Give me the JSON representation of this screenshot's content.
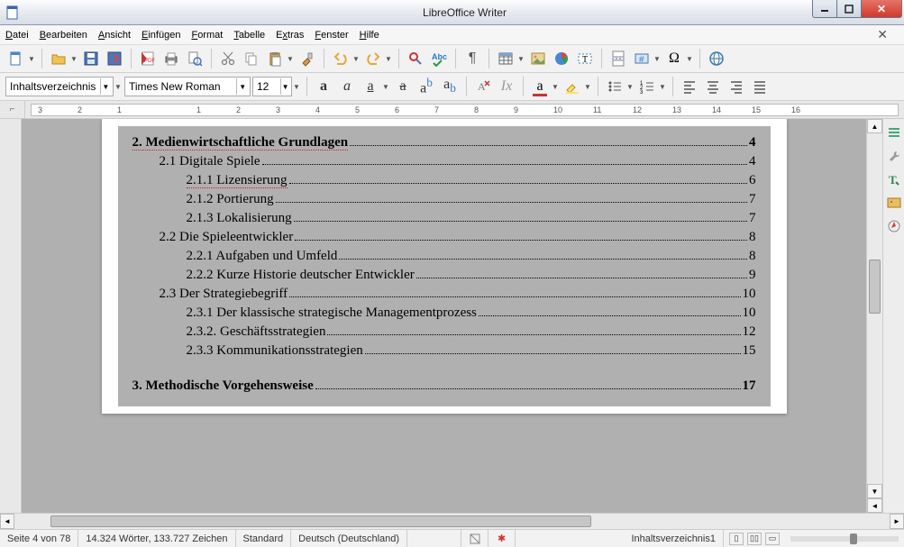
{
  "title": "LibreOffice Writer",
  "menu": [
    "Datei",
    "Bearbeiten",
    "Ansicht",
    "Einfügen",
    "Format",
    "Tabelle",
    "Extras",
    "Fenster",
    "Hilfe"
  ],
  "menu_accel": [
    0,
    0,
    0,
    0,
    0,
    0,
    1,
    0,
    0
  ],
  "fmt": {
    "style": "Inhaltsverzeichnis",
    "font": "Times New Roman",
    "size": "12"
  },
  "ruler": {
    "start": -3,
    "end": 16
  },
  "toc": [
    {
      "level": 1,
      "num": "2.",
      "text": "Medienwirtschaftliche Grundlagen",
      "page": "4",
      "redline": true
    },
    {
      "level": 2,
      "num": "2.1",
      "text": "Digitale Spiele",
      "page": "4"
    },
    {
      "level": 3,
      "num": "2.1.1",
      "text": "Lizensierung",
      "page": "6",
      "redline": true
    },
    {
      "level": 3,
      "num": "2.1.2",
      "text": "Portierung",
      "page": "7"
    },
    {
      "level": 3,
      "num": "2.1.3",
      "text": "Lokalisierung",
      "page": "7"
    },
    {
      "level": 2,
      "num": "2.2",
      "text": "Die Spieleentwickler",
      "page": "8"
    },
    {
      "level": 3,
      "num": "2.2.1",
      "text": "Aufgaben und Umfeld",
      "page": "8"
    },
    {
      "level": 3,
      "num": "2.2.2",
      "text": "Kurze Historie deutscher Entwickler",
      "page": "9"
    },
    {
      "level": 2,
      "num": "2.3",
      "text": "Der Strategiebegriff",
      "page": "10"
    },
    {
      "level": 3,
      "num": "2.3.1",
      "text": "Der klassische strategische Managementprozess",
      "page": "10"
    },
    {
      "level": 3,
      "num": "2.3.2.",
      "text": "Geschäftsstrategien",
      "page": "12"
    },
    {
      "level": 3,
      "num": "2.3.3",
      "text": "Kommunikationsstrategien",
      "page": "15"
    },
    {
      "level": 1,
      "num": "3.",
      "text": "Methodische Vorgehensweise",
      "page": "17"
    }
  ],
  "status": {
    "page": "Seite 4 von 78",
    "words": "14.324 Wörter, 133.727 Zeichen",
    "pagestyle": "Standard",
    "lang": "Deutsch (Deutschland)",
    "style_ind": "Inhaltsverzeichnis1"
  }
}
